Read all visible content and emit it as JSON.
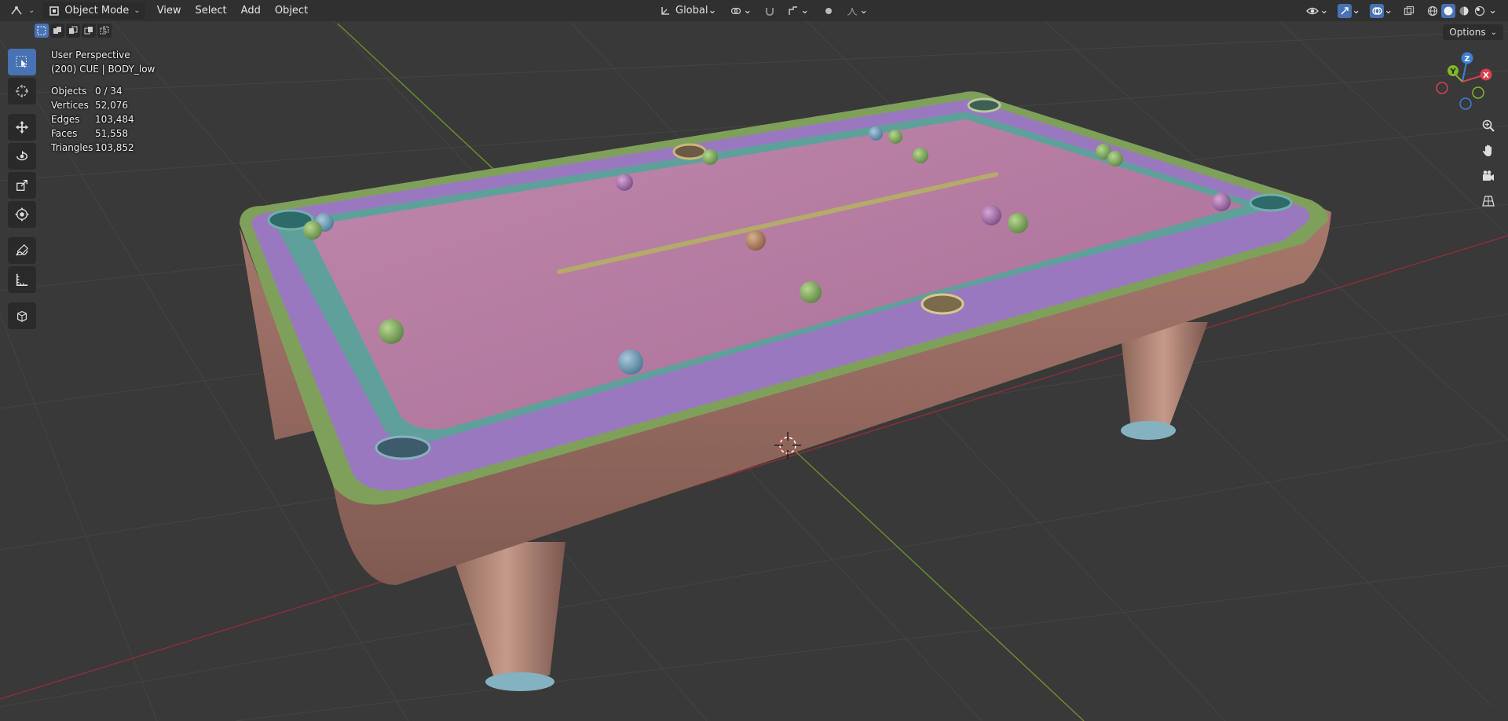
{
  "header": {
    "editor_type_icon": "view3d-icon",
    "mode_label": "Object Mode",
    "menus": [
      "View",
      "Select",
      "Add",
      "Object"
    ],
    "orientation_label": "Global",
    "options_label": "Options"
  },
  "overlay": {
    "view_name": "User Perspective",
    "object_info": "(200) CUE | BODY_low",
    "stats": [
      {
        "label": "Objects",
        "value": "0 / 34"
      },
      {
        "label": "Vertices",
        "value": "52,076"
      },
      {
        "label": "Edges",
        "value": "103,484"
      },
      {
        "label": "Faces",
        "value": "51,558"
      },
      {
        "label": "Triangles",
        "value": "103,852"
      }
    ]
  },
  "gizmo": {
    "x": "X",
    "y": "Y",
    "z": "Z"
  },
  "tools": [
    {
      "name": "select-box-icon",
      "active": true
    },
    {
      "name": "cursor-icon",
      "active": false
    },
    {
      "name": "move-icon",
      "active": false
    },
    {
      "name": "rotate-icon",
      "active": false
    },
    {
      "name": "scale-icon",
      "active": false
    },
    {
      "name": "transform-icon",
      "active": false
    },
    {
      "name": "annotate-icon",
      "active": false
    },
    {
      "name": "measure-icon",
      "active": false
    },
    {
      "name": "add-cube-icon",
      "active": false
    }
  ],
  "colors": {
    "viewport_bg": "#393939",
    "header_bg": "#303030",
    "accent_blue": "#4772b3",
    "axis_x": "#d9414f",
    "axis_y": "#83b52c",
    "axis_z": "#3c7fd6",
    "felt": "#b27aa3",
    "rail": "#9a78c0",
    "cushion_teal": "#5fa19a",
    "body_brown": "#9a7068",
    "trim_green": "#7fa05a"
  }
}
